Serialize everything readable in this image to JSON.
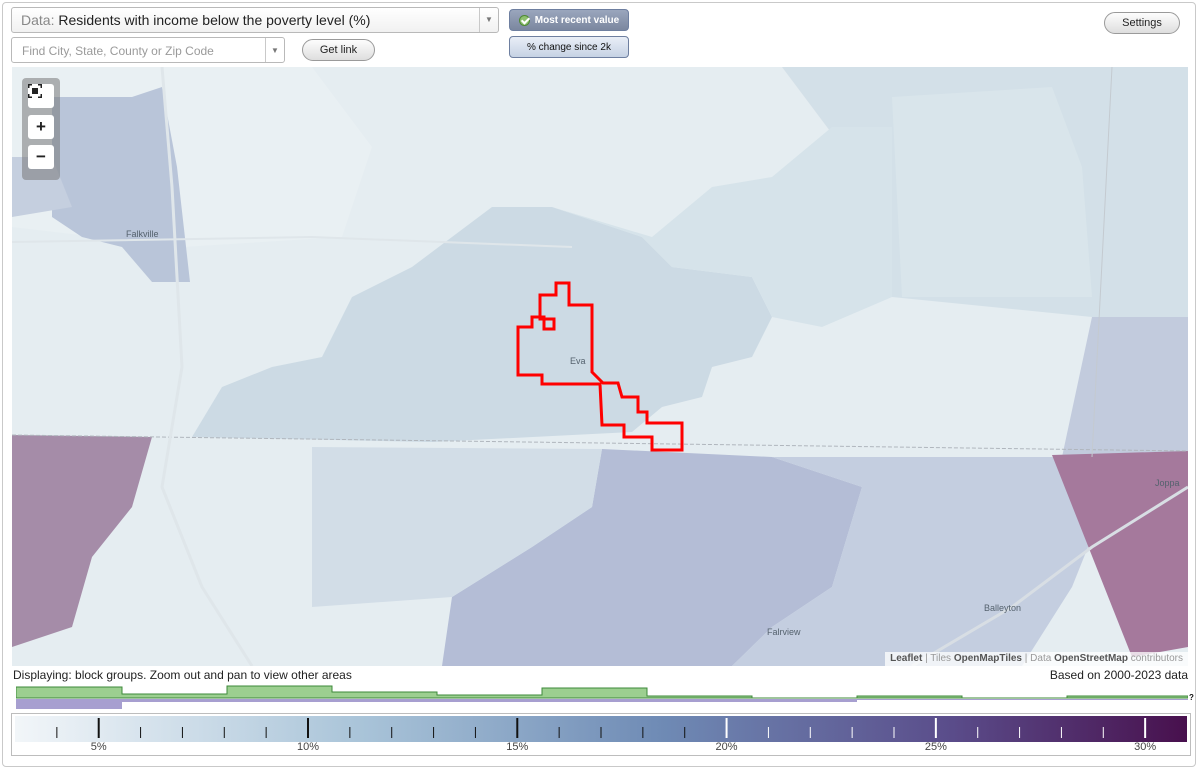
{
  "controls": {
    "data_label": "Data:",
    "data_value": "Residents with income below the poverty level (%)",
    "search_placeholder": "Find City, State, County or Zip Code",
    "get_link": "Get link",
    "settings": "Settings",
    "toggle_recent": "Most recent value",
    "toggle_change": "% change since 2k"
  },
  "map": {
    "places": [
      "Falkville",
      "Eva",
      "Joppa",
      "Falrview",
      "Balleyton"
    ],
    "attribution": {
      "leaflet": "Leaflet",
      "sep1": " | Tiles ",
      "tiles": "OpenMapTiles",
      "sep2": " | Data ",
      "data": "OpenStreetMap",
      "contrib": " contributors"
    },
    "zoom": {
      "full_icon": "fullscreen-icon",
      "plus": "+",
      "minus": "−"
    },
    "colors": {
      "boundary": "#ff0000",
      "light": "#e3ecf1",
      "mid": "#ccdce6",
      "blue": "#b4bfd8",
      "purple": "#a97d9e"
    }
  },
  "footer": {
    "displaying": "Displaying: block groups. Zoom out and pan to view other areas",
    "based": "Based on 2000-2023 data",
    "question": "?"
  },
  "legend": {
    "ticks": [
      "5%",
      "10%",
      "15%",
      "20%",
      "25%",
      "30%"
    ],
    "min": 3,
    "max": 31,
    "gradient": [
      "#f2f6f9",
      "#9ab7cf",
      "#6a86b1",
      "#5b4f8c",
      "#4a1450"
    ]
  }
}
